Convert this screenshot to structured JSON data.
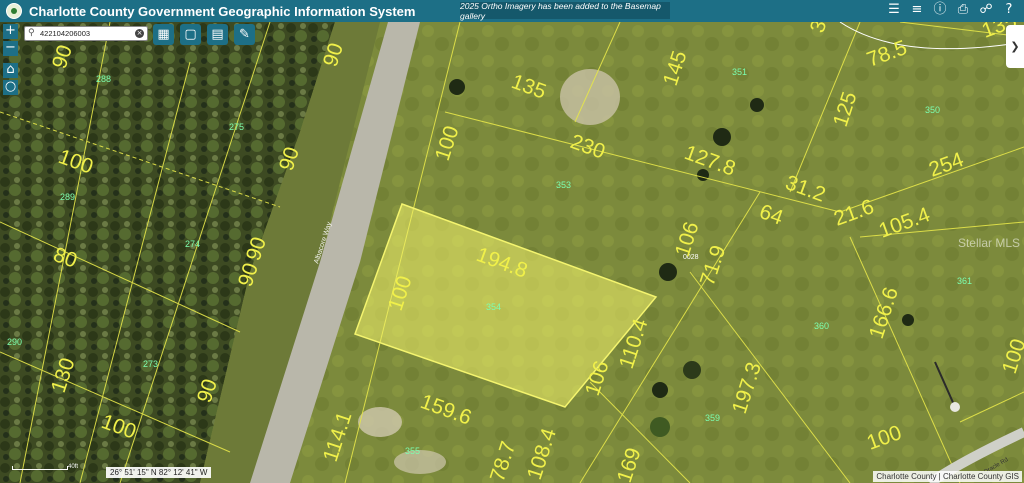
{
  "header": {
    "title": "Charlotte County Government Geographic Information System",
    "notice": "2025 Ortho Imagery has been added to the Basemap gallery",
    "icons": [
      "layers-icon",
      "legend-icon",
      "info-icon",
      "print-icon",
      "handshake-icon",
      "help-icon"
    ]
  },
  "search": {
    "value": "422104206003",
    "clear_icon": "close-icon"
  },
  "tools": [
    "basemap-gallery-icon",
    "select-icon",
    "notes-icon",
    "draw-icon"
  ],
  "zoom": {
    "in": "+",
    "out": "−"
  },
  "side_tab": "❯",
  "colors": {
    "header": "#1d6f86",
    "parcel_line": "#e6e64a",
    "selected_fill": "#f2f26a",
    "parcel_number": "#7dffb0"
  },
  "map": {
    "street": "Albacore Way",
    "street2": "Oracle Rd",
    "selected_parcel": {
      "label": "354",
      "code": "0028"
    },
    "parcel_numbers": [
      "288",
      "275",
      "289",
      "274",
      "273",
      "290",
      "351",
      "350",
      "353",
      "361",
      "360",
      "359",
      "355"
    ],
    "dimensions": [
      "90",
      "90",
      "100",
      "90",
      "90",
      "80",
      "90",
      "130",
      "90",
      "100",
      "100",
      "135",
      "145",
      "78.5",
      "125",
      "230",
      "127.8",
      "254",
      "31.2",
      "64",
      "21.6",
      "105.4",
      "194.8",
      "100",
      "106",
      "71.9",
      "166.6",
      "110.4",
      "106",
      "197.3",
      "159.6",
      "114.1",
      "78.7",
      "108.4",
      "169",
      "100",
      "100",
      "3",
      "135"
    ]
  },
  "coordinates": "26° 51' 15\" N 82° 12' 41\" W",
  "scale_label": "40ft",
  "attribution": "Charlotte County | Charlotte County GIS",
  "watermark": "Stellar MLS"
}
